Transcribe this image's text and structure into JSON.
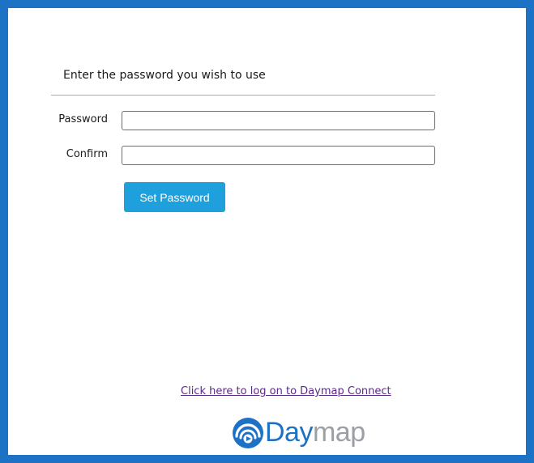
{
  "form": {
    "heading": "Enter the password you wish to use",
    "password_label": "Password",
    "password_value": "",
    "confirm_label": "Confirm",
    "confirm_value": "",
    "submit_label": "Set Password"
  },
  "footer": {
    "logon_link": "Click here to log on to Daymap Connect",
    "logo_word_primary": "Day",
    "logo_word_secondary": "map",
    "logo_icon": "daymap-logo-icon"
  },
  "colors": {
    "frame_border": "#1e72c6",
    "button": "#1ea0dc",
    "link": "#5b2a86",
    "logo_primary": "#1e72c6",
    "logo_secondary": "#9aa0a6"
  }
}
